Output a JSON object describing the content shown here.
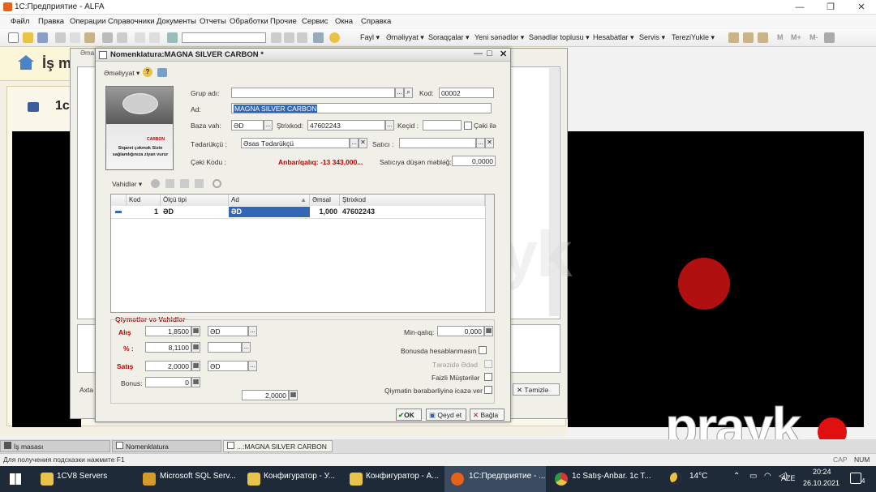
{
  "window": {
    "title": "1C:Предприятие - ALFA"
  },
  "menubar": [
    "Файл",
    "Правка",
    "Операции",
    "Справочники",
    "Документы",
    "Отчеты",
    "Обработки",
    "Прочие",
    "Сервис",
    "Окна",
    "Справка"
  ],
  "toolbar": {
    "menus": [
      "Fayl",
      "Əməliyyat",
      "Soraqçalar",
      "Yeni sənədlər",
      "Sənədlər toplusu",
      "Hesabatlar",
      "Servis",
      "TereziYukle"
    ],
    "letters": [
      "M",
      "M+",
      "M-"
    ]
  },
  "bg": {
    "home_title": "İş m",
    "panel_label": "1c",
    "tab_stub": "Əma",
    "bottom_text": "Axta",
    "clear_button": "Təmizlə"
  },
  "watermark": "prayk",
  "dialog": {
    "title": "Nomenklatura:MAGNA SILVER CARBON *",
    "actions_label": "Əməliyyat",
    "help_icon": "?",
    "labels": {
      "group": "Grup adı:",
      "code": "Kod:",
      "name": "Ad:",
      "base_unit": "Baza vah:",
      "barcode": "Ştrixkod:",
      "transit": "Keçid :",
      "weight": "Çəki ilə",
      "supplier": "Tədarükçü :",
      "seller": "Satıcı :",
      "weight_code": "Çəki Kodu :",
      "stock": "Anbar/qalıq: -13 343,000...",
      "seller_amount": "Satıcıya düşən məbləğ:"
    },
    "values": {
      "group": "",
      "code": "00002",
      "name": "MAGNA SILVER CARBON",
      "base_unit": "ƏD",
      "barcode": "47602243",
      "transit": "",
      "supplier": "Əsas Tədarükçü",
      "seller": "",
      "seller_amount": "0,0000"
    },
    "product_image_text": {
      "brand": "CARBON",
      "warning": "Siqaret çəkmək Sizin sağlamlığınıza ziyan vurur"
    },
    "units": {
      "menu_label": "Vahidlər",
      "columns": [
        "Kod",
        "Ölçü tipi",
        "Ad",
        "Əmsal",
        "Ştrixkod"
      ],
      "rows": [
        {
          "kod": "1",
          "olcu": "ƏD",
          "ad": "ƏD",
          "emsal": "1,000",
          "strixkod": "47602243"
        }
      ]
    },
    "prices": {
      "section_title": "Qiymətlər və Vahidlər",
      "alis_label": "Alış",
      "alis_value": "1,8500",
      "alis_unit": "ƏD",
      "percent_label": "% :",
      "percent_value": "8,1100",
      "percent_unit": "",
      "satis_label": "Satış",
      "satis_value": "2,0000",
      "satis_unit": "ƏD",
      "bonus_label": "Bonus:",
      "bonus_value": "0",
      "extra_value": "2,0000",
      "min_label": "Min-qalıq:",
      "min_value": "0,000",
      "checks": [
        {
          "label": "Bonusda hesablanmasın",
          "enabled": true,
          "checked": false
        },
        {
          "label": "Tərəzidə Ədəd",
          "enabled": false,
          "checked": false
        },
        {
          "label": "Faizli Müştərilər",
          "enabled": true,
          "checked": false
        },
        {
          "label": "Qiymətin bərabərliyinə icazə ver",
          "enabled": true,
          "checked": false
        }
      ]
    },
    "buttons": {
      "ok": "OK",
      "save": "Qeyd et",
      "close": "Bağla"
    }
  },
  "doc_tabs": [
    "İş masası",
    "Nomenklatura",
    "...:MAGNA SILVER CARBON *"
  ],
  "status": {
    "hint": "Для получения подсказки нажмите F1",
    "caps": "CAP",
    "num": "NUM"
  },
  "taskbar": {
    "items": [
      "1CV8 Servers",
      "Microsoft SQL Serv...",
      "Конфигуратор - У...",
      "Конфигуратор - А...",
      "1С:Предприятие - ...",
      "1c Satış-Anbar. 1c T..."
    ],
    "weather": "14°C",
    "lang": "AZE",
    "time": "20:24",
    "date": "26.10.2021",
    "notifications": "4"
  }
}
